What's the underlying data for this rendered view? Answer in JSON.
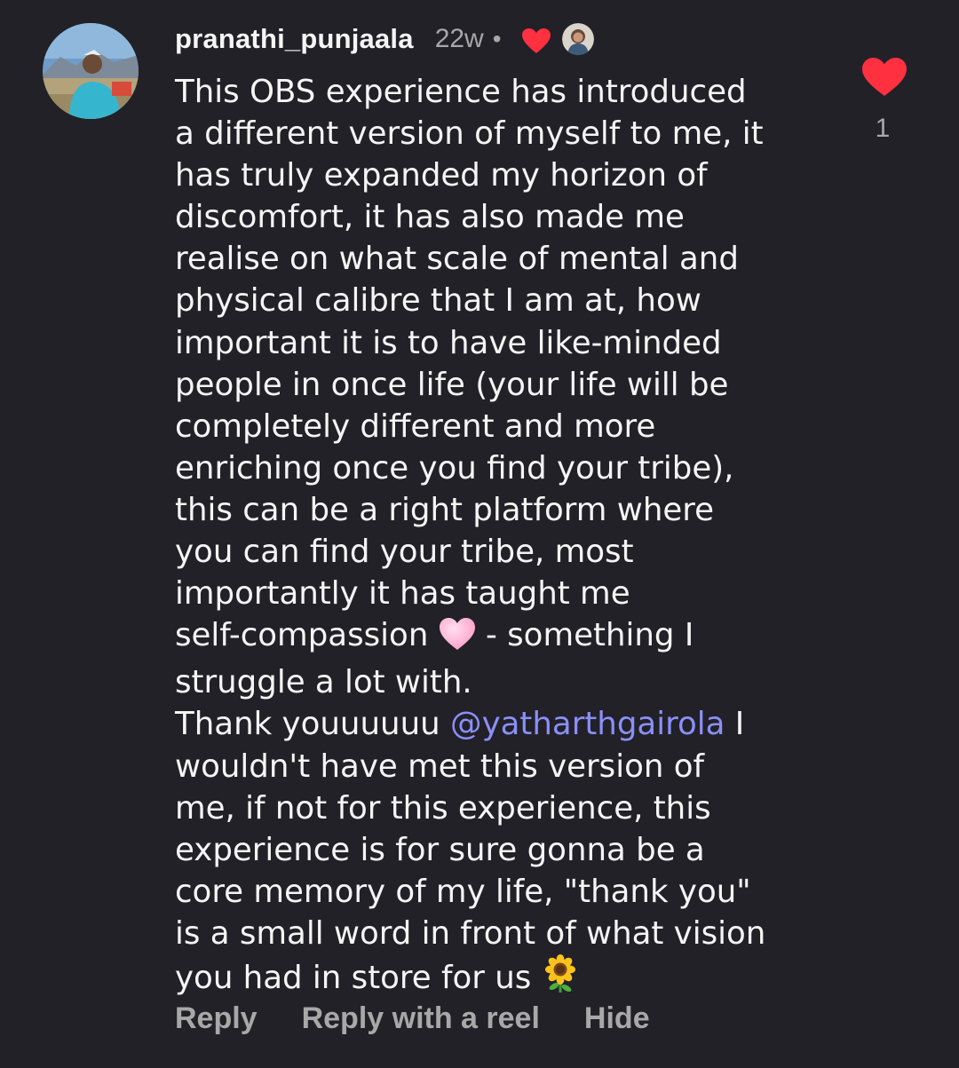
{
  "comment": {
    "username": "pranathi_punjaala",
    "timestamp": "22w",
    "separator": "•",
    "body_lines": [
      "This OBS experience has introduced",
      "a different version of myself to me, it",
      "has truly expanded my horizon of",
      "discomfort, it has also made me",
      "realise on what scale of mental and",
      "physical calibre that I am at, how",
      "important it is to have like-minded",
      "people in once life (your life will be",
      "completely different and more",
      "enriching once you find your tribe),",
      "this can be a right platform where",
      "you can find your tribe, most",
      "importantly it has taught me"
    ],
    "line14_before": "self-compassion ",
    "line14_after": " - something I",
    "line15": "struggle a lot with.",
    "line16_before": "Thank youuuuuu ",
    "mention": "@yatharthgairola",
    "line16_after": " I",
    "body_lines_2": [
      "wouldn't have met this version of",
      "me, if not for this experience, this",
      "experience is for sure gonna be a",
      "core memory of my life, \"thank you\"",
      "is a small word in front of what vision"
    ],
    "last_line": "you had in store for us ",
    "emojis": [
      "pink-heart-emoji",
      "sunflower-emoji"
    ],
    "like_count": "1",
    "icons": [
      "avatar",
      "creator-liked-heart-icon",
      "creator-avatar",
      "heart-icon"
    ]
  },
  "actions": {
    "reply": "Reply",
    "reply_with_reel": "Reply with a reel",
    "hide": "Hide"
  },
  "colors": {
    "background": "#212127",
    "text": "#f5f5f5",
    "secondary_text": "#a8a8a8",
    "mention": "#8b8ff8",
    "heart": "#ff3040"
  }
}
